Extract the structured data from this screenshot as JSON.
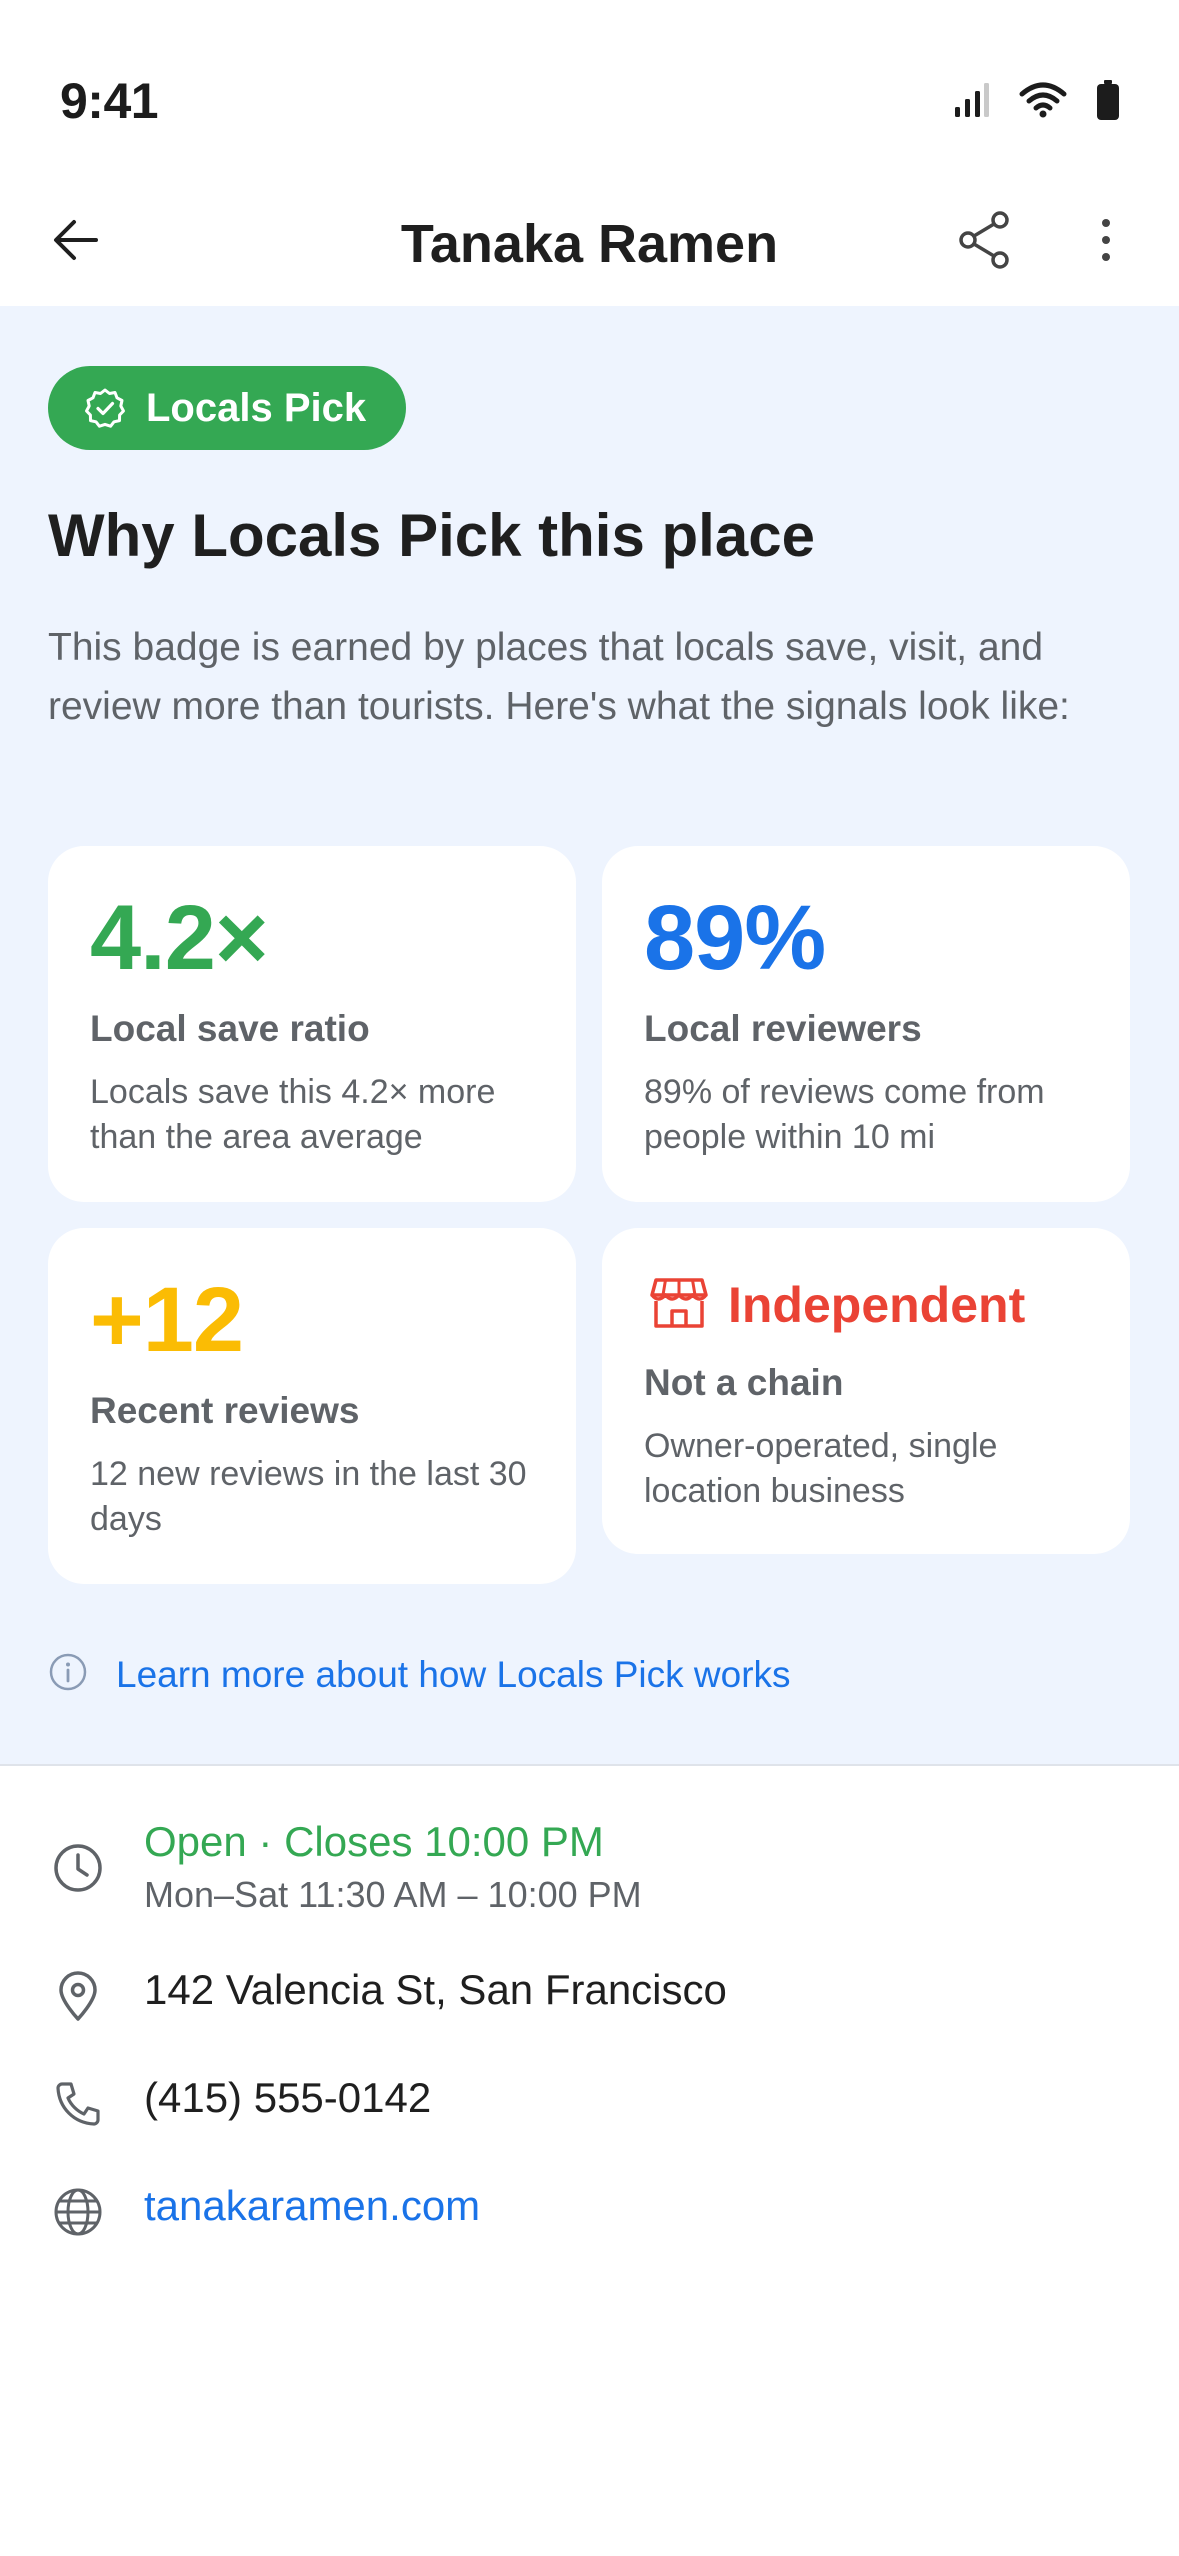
{
  "status_bar": {
    "time": "9:41",
    "icons": [
      "signal-icon",
      "wifi-icon",
      "battery-icon"
    ]
  },
  "app_bar": {
    "title": "Tanaka Ramen",
    "back_icon": "back-arrow-icon",
    "share_icon": "share-icon",
    "more_icon": "more-vertical-icon"
  },
  "badge": {
    "label": "Locals Pick",
    "icon": "verified-badge-icon",
    "heading": "Why Locals Pick this place",
    "description": "This badge is earned by places that locals save, visit, and review more than tourists. Here's what the signals look like:",
    "cards": [
      {
        "value": "4.2×",
        "label": "Local save ratio",
        "description": "Locals save this 4.2× more than the area average",
        "color": "#34a853"
      },
      {
        "value": "89%",
        "label": "Local reviewers",
        "description": "89% of reviews come from people within 10 mi",
        "color": "#1a73e8"
      },
      {
        "value": "+12",
        "label": "Recent reviews",
        "description": "12 new reviews in the last 30 days",
        "color": "#fbbc04"
      },
      {
        "value": "Independent",
        "icon": "storefront-icon",
        "label": "Not a chain",
        "description": "Owner-operated, single location business",
        "color": "#ea4335"
      }
    ],
    "learn_more": "Learn more about how Locals Pick works"
  },
  "info": {
    "hours_status": "Open · Closes 10:00 PM",
    "hours_detail": "Mon–Sat 11:30 AM – 10:00 PM",
    "address": "142 Valencia St, San Francisco",
    "phone": "(415) 555-0142",
    "website": "tanakaramen.com"
  },
  "colors": {
    "accent_green": "#34a853",
    "accent_blue": "#1a73e8",
    "accent_yellow": "#fbbc04",
    "accent_red": "#ea4335",
    "section_background": "#eef4fe"
  }
}
